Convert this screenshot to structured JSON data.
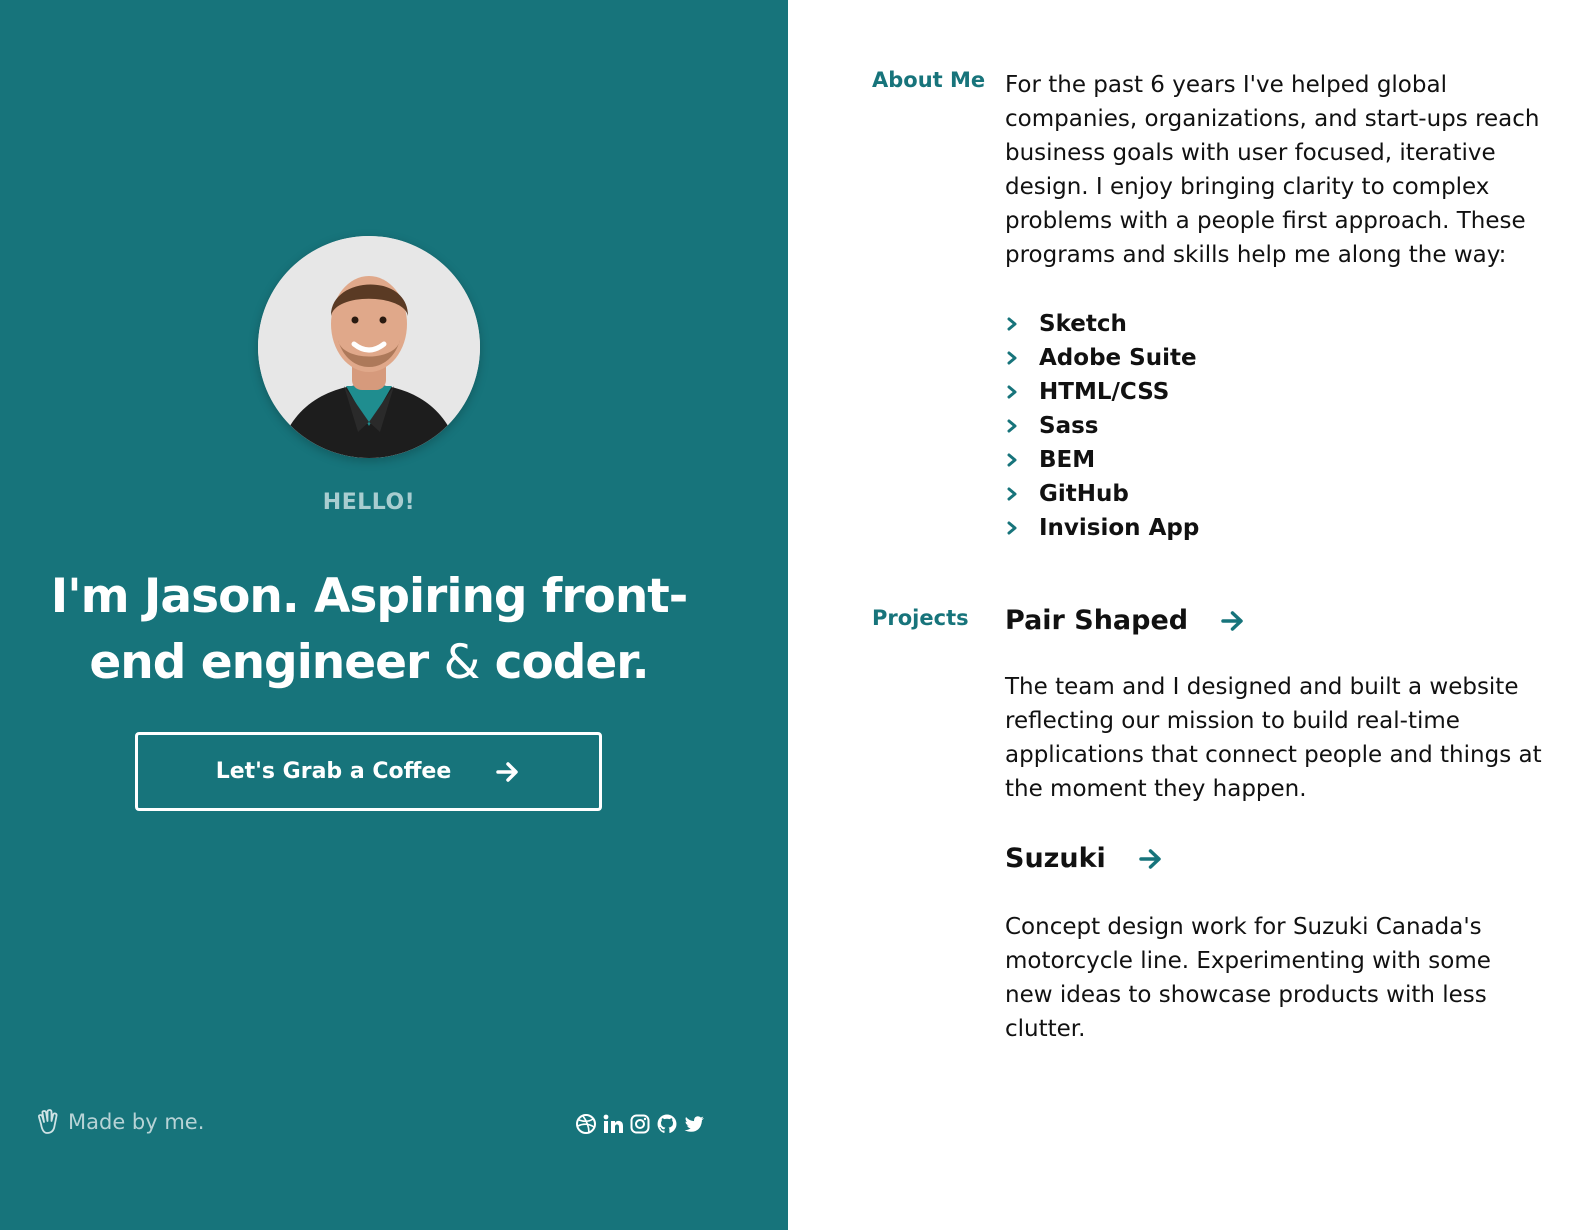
{
  "hero": {
    "greeting": "HELLO!",
    "headline_part1": "I'm Jason. Aspiring front-end engineer",
    "headline_amp": "&",
    "headline_part2": "coder.",
    "cta_label": "Let's Grab a Coffee"
  },
  "footer": {
    "made_by": "Made by me.",
    "social": [
      "dribbble-icon",
      "linkedin-icon",
      "instagram-icon",
      "github-icon",
      "twitter-icon"
    ]
  },
  "about": {
    "label": "About Me",
    "text": "For the past 6 years I've helped global companies, organizations, and start-ups reach business goals with user focused, iterative design. I enjoy bringing clarity to complex problems with a people first approach. These programs and skills help me along the way:",
    "skills": [
      "Sketch",
      "Adobe Suite",
      "HTML/CSS",
      "Sass",
      "BEM",
      "GitHub",
      "Invision App"
    ]
  },
  "projects": {
    "label": "Projects",
    "items": [
      {
        "title": "Pair Shaped",
        "description": "The team and I designed and built a website reflecting our mission to build real-time applications that connect people and things at the moment they happen."
      },
      {
        "title": "Suzuki",
        "description": "Concept design work for Suzuki Canada's motorcycle line. Experimenting with some new ideas to showcase products with less clutter."
      }
    ]
  },
  "colors": {
    "accent": "#17747b",
    "panel_bg": "#17747b",
    "greeting": "#a9cdd0"
  }
}
